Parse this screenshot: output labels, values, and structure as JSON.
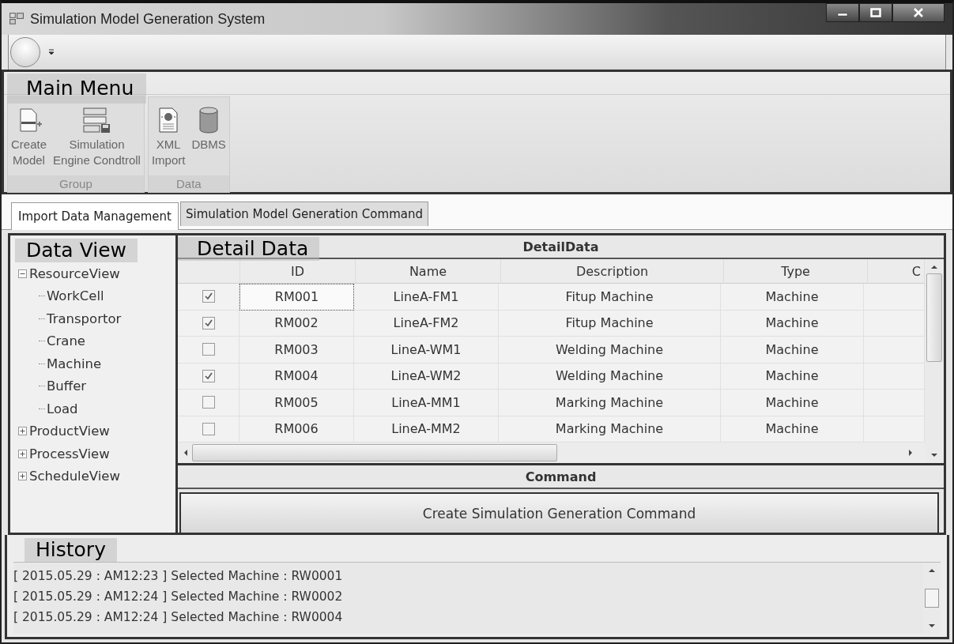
{
  "window": {
    "title": "Simulation Model Generation System"
  },
  "main_menu": {
    "annotation": "Main Menu",
    "groups": [
      {
        "label": "Group",
        "buttons": [
          {
            "kind": "new-document",
            "lines": [
              "Create",
              "Model"
            ]
          },
          {
            "kind": "layout-save",
            "lines": [
              "Simulation",
              "Engine Condtroll"
            ]
          }
        ]
      },
      {
        "label": "Data",
        "buttons": [
          {
            "kind": "xml-file",
            "lines": [
              "XML",
              "Import"
            ]
          },
          {
            "kind": "database",
            "lines": [
              "DBMS"
            ]
          }
        ]
      }
    ]
  },
  "tabs": [
    {
      "label": "Import Data Management",
      "selected": true
    },
    {
      "label": "Simulation Model Generation Command",
      "selected": false
    }
  ],
  "data_view": {
    "annotation": "Data View",
    "tree": [
      {
        "label": "ResourceView",
        "expanded": true,
        "children": [
          {
            "label": "WorkCell"
          },
          {
            "label": "Transportor"
          },
          {
            "label": "Crane"
          },
          {
            "label": "Machine"
          },
          {
            "label": "Buffer"
          },
          {
            "label": "Load"
          }
        ]
      },
      {
        "label": "ProductView",
        "expanded": false
      },
      {
        "label": "ProcessView",
        "expanded": false
      },
      {
        "label": "ScheduleView",
        "expanded": false
      }
    ]
  },
  "detail_data": {
    "annotation": "Detail Data",
    "title": "DetailData",
    "columns": [
      "ID",
      "Name",
      "Description",
      "Type",
      "C"
    ],
    "rows": [
      {
        "checked": true,
        "focused": true,
        "cells": [
          "RM001",
          "LineA-FM1",
          "Fitup Machine",
          "Machine"
        ]
      },
      {
        "checked": true,
        "focused": false,
        "cells": [
          "RM002",
          "LineA-FM2",
          "Fitup Machine",
          "Machine"
        ]
      },
      {
        "checked": false,
        "focused": false,
        "cells": [
          "RM003",
          "LineA-WM1",
          "Welding Machine",
          "Machine"
        ]
      },
      {
        "checked": true,
        "focused": false,
        "cells": [
          "RM004",
          "LineA-WM2",
          "Welding Machine",
          "Machine"
        ]
      },
      {
        "checked": false,
        "focused": false,
        "cells": [
          "RM005",
          "LineA-MM1",
          "Marking Machine",
          "Machine"
        ]
      },
      {
        "checked": false,
        "focused": false,
        "cells": [
          "RM006",
          "LineA-MM2",
          "Marking Machine",
          "Machine"
        ]
      }
    ]
  },
  "command": {
    "title": "Command",
    "button": "Create Simulation Generation Command"
  },
  "history": {
    "annotation": "History",
    "lines": [
      "[ 2015.05.29 : AM12:23 ] Selected Machine : RW0001",
      "[ 2015.05.29 : AM12:24 ] Selected Machine : RW0002",
      "[ 2015.05.29 : AM12:24 ] Selected Machine : RW0004"
    ]
  }
}
